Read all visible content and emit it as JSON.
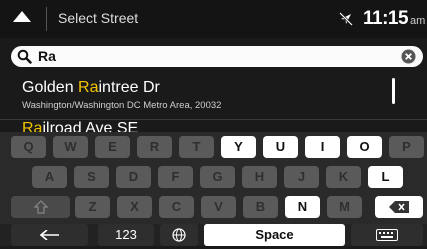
{
  "header": {
    "title": "Select Street",
    "time": "11:15",
    "ampm": "am",
    "icons": [
      "back-arrow-icon",
      "gps-off-icon",
      "messages-icon"
    ]
  },
  "search": {
    "query": "Ra",
    "icon": "search-icon",
    "clear_icon": "clear-icon"
  },
  "results": [
    {
      "name_pre": "Golden ",
      "name_match": "Ra",
      "name_post": "intree Dr",
      "subtitle": "Washington/Washington DC Metro Area, 20032"
    },
    {
      "name_pre": "",
      "name_match": "Ra",
      "name_post": "ilroad Ave SE",
      "subtitle": ""
    }
  ],
  "keyboard": {
    "rows": [
      [
        "Q",
        "W",
        "E",
        "R",
        "T",
        "Y",
        "U",
        "I",
        "O",
        "P"
      ],
      [
        "A",
        "S",
        "D",
        "F",
        "G",
        "H",
        "J",
        "K",
        "L"
      ],
      [
        "Z",
        "X",
        "C",
        "V",
        "B",
        "N",
        "M"
      ]
    ],
    "enabled_keys": [
      "Y",
      "U",
      "I",
      "O",
      "L",
      "N"
    ],
    "shift_icon": "shift-icon",
    "backspace_icon": "backspace-icon",
    "bottom": {
      "back_icon": "left-arrow-icon",
      "numbers_label": "123",
      "globe_icon": "globe-icon",
      "space_label": "Space",
      "keyboard_icon": "keyboard-icon"
    }
  },
  "colors": {
    "highlight": "#f2c200",
    "enabled_key": "#ffffff",
    "disabled_key": "#5a5a5a"
  }
}
